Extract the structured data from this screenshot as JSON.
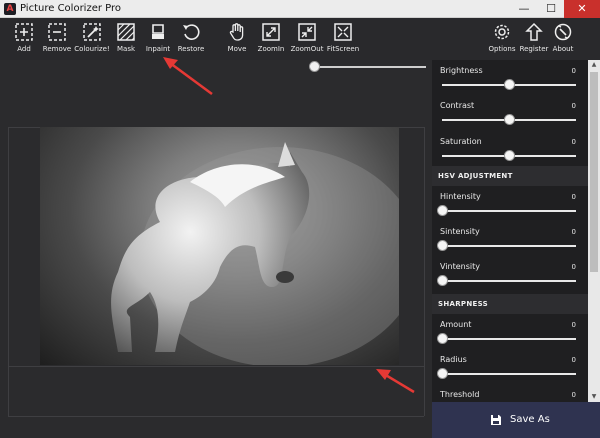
{
  "window": {
    "logo_letter": "A",
    "title": "Picture Colorizer Pro",
    "buttons": {
      "minimize": "—",
      "maximize": "☐",
      "close": "✕"
    }
  },
  "toolbar": {
    "add": "Add",
    "remove": "Remove",
    "colourize": "Colourize!",
    "mask": "Mask",
    "inpaint": "Inpaint",
    "restore": "Restore",
    "move": "Move",
    "zoomin": "ZoomIn",
    "zoomout": "ZoomOut",
    "fitscreen": "FitScreen",
    "options": "Options",
    "register": "Register",
    "about": "About"
  },
  "zoom": {
    "level": 0
  },
  "panel": {
    "basic": [
      {
        "name": "Brightness",
        "value": "0",
        "position": 0.5
      },
      {
        "name": "Contrast",
        "value": "0",
        "position": 0.5
      },
      {
        "name": "Saturation",
        "value": "0",
        "position": 0.5
      }
    ],
    "hsv_heading": "HSV ADJUSTMENT",
    "hsv": [
      {
        "name": "Hintensity",
        "value": "0",
        "position": 0
      },
      {
        "name": "Sintensity",
        "value": "0",
        "position": 0
      },
      {
        "name": "Vintensity",
        "value": "0",
        "position": 0
      }
    ],
    "sharpness_heading": "SHARPNESS",
    "sharpness": [
      {
        "name": "Amount",
        "value": "0",
        "position": 0
      },
      {
        "name": "Radius",
        "value": "0",
        "position": 0
      },
      {
        "name": "Threshold",
        "value": "0",
        "position": 0
      }
    ]
  },
  "save_label": "Save As",
  "colors": {
    "accent_arrow": "#e53935",
    "save_button": "#2f3350"
  }
}
